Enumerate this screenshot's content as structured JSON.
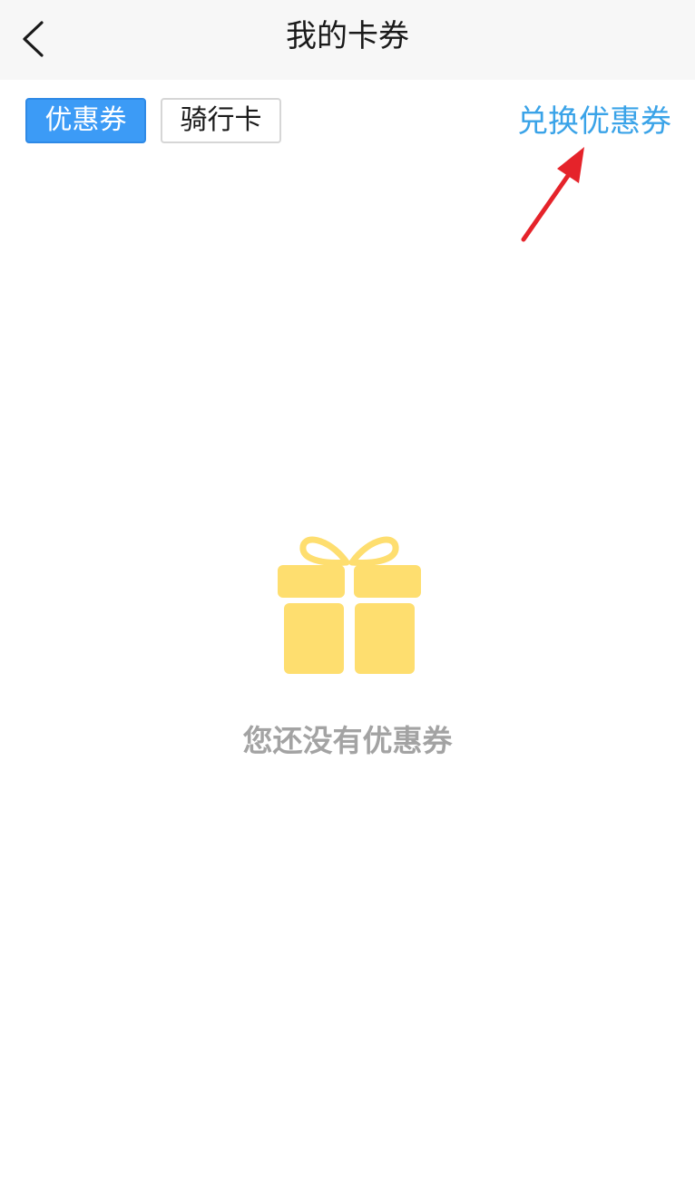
{
  "header": {
    "title": "我的卡券"
  },
  "tabs": [
    {
      "label": "优惠券",
      "selected": true
    },
    {
      "label": "骑行卡",
      "selected": false
    }
  ],
  "actions": {
    "redeem_label": "兑换优惠券"
  },
  "empty_state": {
    "message": "您还没有优惠券",
    "icon": "gift-icon"
  },
  "annotation": {
    "icon": "red-arrow-icon"
  },
  "colors": {
    "accent_blue": "#3c9bf6",
    "link_blue": "#3aa3e8",
    "gift_yellow": "#fede6f",
    "arrow_red": "#e5232a",
    "header_bg": "#f7f7f7",
    "muted_text": "#a3a3a3"
  }
}
